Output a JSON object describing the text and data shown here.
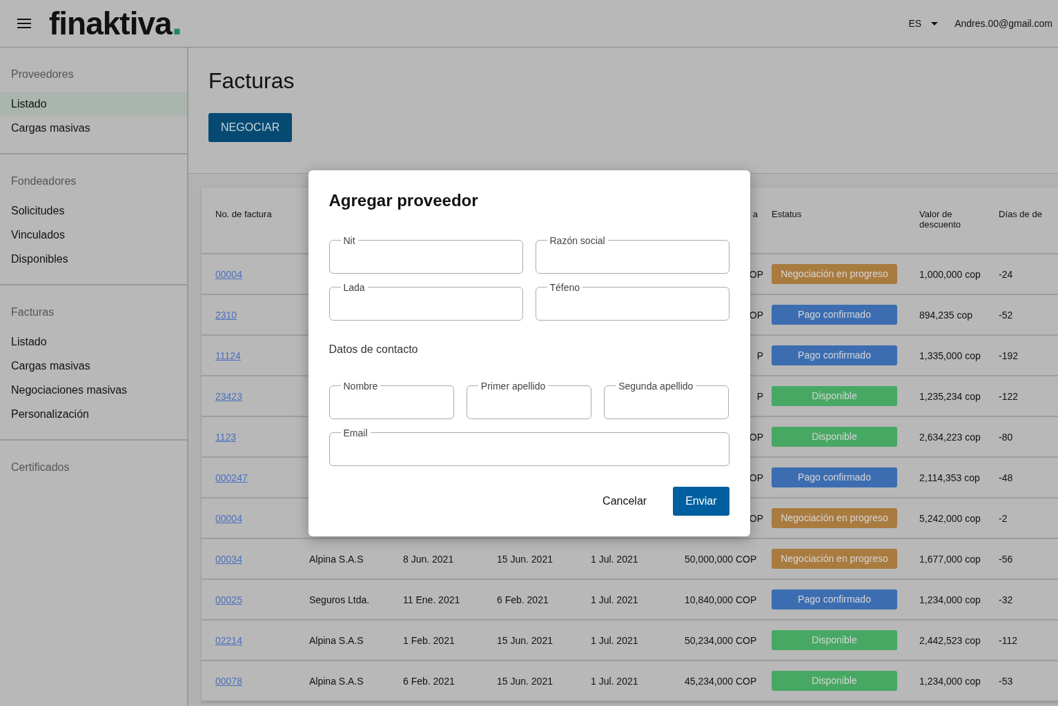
{
  "header": {
    "logo": {
      "text": "finaktiva",
      "mark": "."
    },
    "language": "ES",
    "user_email": "Andres.00@gmail.com"
  },
  "sidebar": {
    "sections": [
      {
        "heading": "Proveedores",
        "items": [
          {
            "label": "Listado",
            "selected": true
          },
          {
            "label": "Cargas masivas",
            "selected": false
          }
        ]
      },
      {
        "heading": "Fondeadores",
        "items": [
          {
            "label": "Solicitudes",
            "selected": false
          },
          {
            "label": "Vinculados",
            "selected": false
          },
          {
            "label": "Disponibles",
            "selected": false
          }
        ]
      },
      {
        "heading": "Facturas",
        "items": [
          {
            "label": "Listado",
            "selected": false
          },
          {
            "label": "Cargas masivas",
            "selected": false
          },
          {
            "label": "Negociaciones masivas",
            "selected": false
          },
          {
            "label": "Personalización",
            "selected": false
          }
        ]
      },
      {
        "heading": "Certificados"
      }
    ]
  },
  "page": {
    "title": "Facturas",
    "action_button": "NEGOCIAR"
  },
  "table": {
    "columns": [
      {
        "label": "No. de factura"
      },
      {
        "label": "a"
      },
      {
        "label": "Estatus"
      },
      {
        "label": "Valor de descuento"
      },
      {
        "label": "Días de de"
      }
    ],
    "rows": [
      {
        "invoice": "00004",
        "amount": "OP",
        "status": {
          "label": "Negociación en progreso",
          "color": "#a97b3f"
        },
        "discount": "1,000,000 cop",
        "days": "-24"
      },
      {
        "invoice": "2310",
        "amount": "OP",
        "status": {
          "label": "Pago confirmado",
          "color": "#3c6db1"
        },
        "discount": "894,235 cop",
        "days": "-52"
      },
      {
        "invoice": "11124",
        "amount": "P",
        "status": {
          "label": "Pago confirmado",
          "color": "#3c6db1"
        },
        "discount": "1,335,000 cop",
        "days": "-192"
      },
      {
        "invoice": "23423",
        "amount": "P",
        "status": {
          "label": "Disponible",
          "color": "#47a864"
        },
        "discount": "1,235,234 cop",
        "days": "-122"
      },
      {
        "invoice": "1123",
        "amount": "OP",
        "status": {
          "label": "Disponible",
          "color": "#47a864"
        },
        "discount": "2,634,223 cop",
        "days": "-80"
      },
      {
        "invoice": "000247",
        "amount": "OP",
        "status": {
          "label": "Pago confirmado",
          "color": "#3c6db1"
        },
        "discount": "2,114,353 cop",
        "days": "-48"
      },
      {
        "invoice": "00004",
        "amount": "OP",
        "status": {
          "label": "Negociación en progreso",
          "color": "#a97b3f"
        },
        "discount": "5,242,000 cop",
        "days": "-2"
      },
      {
        "invoice": "00034",
        "supplier": "Alpina S.A.S",
        "issue_date": "8 Jun. 2021",
        "due_date": "15 Jun. 2021",
        "payment_date": "1 Jul. 2021",
        "amount": "50,000,000 COP",
        "status": {
          "label": "Negociación en progreso",
          "color": "#a97b3f"
        },
        "discount": "1,677,000 cop",
        "days": "-56"
      },
      {
        "invoice": "00025",
        "supplier": "Seguros Ltda.",
        "issue_date": "11 Ene. 2021",
        "due_date": "6 Feb. 2021",
        "payment_date": "1 Jul. 2021",
        "amount": "10,840,000 COP",
        "status": {
          "label": "Pago confirmado",
          "color": "#3c6db1"
        },
        "discount": "1,234,000 cop",
        "days": "-32"
      },
      {
        "invoice": "02214",
        "supplier": "Alpina S.A.S",
        "issue_date": "1 Feb. 2021",
        "due_date": "15 Jun. 2021",
        "payment_date": "1 Jul. 2021",
        "amount": "50,234,000 COP",
        "status": {
          "label": "Disponible",
          "color": "#47a864"
        },
        "discount": "2,442,523 cop",
        "days": "-112"
      },
      {
        "invoice": "00078",
        "supplier": "Alpina S.A.S",
        "issue_date": "6 Feb. 2021",
        "due_date": "15 Jun. 2021",
        "payment_date": "1 Jul. 2021",
        "amount": "45,234,000 COP",
        "status": {
          "label": "Disponible",
          "color": "#47a864"
        },
        "discount": "1,234,000 cop",
        "days": "-53"
      }
    ]
  },
  "dialog": {
    "title": "Agregar proveedor",
    "field_rows": [
      [
        {
          "label": "Nit"
        },
        {
          "label": "Razón social"
        }
      ],
      [
        {
          "label": "Lada"
        },
        {
          "label": "Téfeno"
        }
      ]
    ],
    "section_title": "Datos de contacto",
    "contact_rows": [
      [
        {
          "label": "Nombre"
        },
        {
          "label": "Primer apellido"
        },
        {
          "label": "Segunda apellido"
        }
      ],
      [
        {
          "label": "Email"
        }
      ]
    ],
    "buttons": [
      {
        "label": "Cancelar",
        "kind": "text"
      },
      {
        "label": "Enviar",
        "kind": "primary"
      }
    ]
  }
}
